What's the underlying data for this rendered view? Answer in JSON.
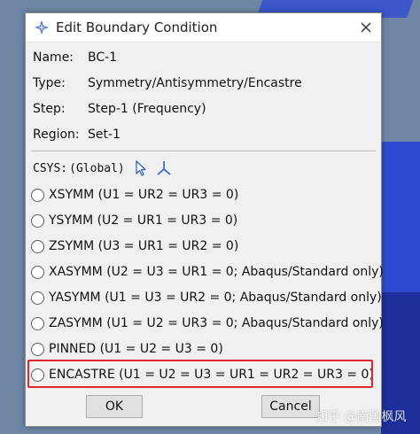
{
  "dialog": {
    "title": "Edit Boundary Condition",
    "info": [
      {
        "label": "Name:",
        "value": "BC-1"
      },
      {
        "label": "Type:",
        "value": "Symmetry/Antisymmetry/Encastre"
      },
      {
        "label": "Step:",
        "value": "Step-1 (Frequency)"
      },
      {
        "label": "Region:",
        "value": "Set-1"
      }
    ],
    "csys_label": "CSYS:",
    "csys_value": "(Global)",
    "options": [
      "XSYMM (U1 = UR2 = UR3 = 0)",
      "YSYMM (U2 = UR1 = UR3 = 0)",
      "ZSYMM (U3 = UR1 = UR2 = 0)",
      "XASYMM (U2 = U3 = UR1 = 0; Abaqus/Standard only)",
      "YASYMM (U1 = U3 = UR2 = 0; Abaqus/Standard only)",
      "ZASYMM (U1 = U2 = UR3 = 0; Abaqus/Standard only)",
      "PINNED (U1 = U2 = U3 = 0)",
      "ENCASTRE (U1 = U2 = U3 = UR1 = UR2 = UR3 = 0)"
    ],
    "highlighted_option": "ENCASTRE (U1 = U2 = U3 = UR1 = UR2 = UR3 = 0)",
    "highlight_color": "#e0272d",
    "ok_label": "OK",
    "cancel_label": "Cancel"
  },
  "watermark": "知乎 @南国枫风",
  "icons": {
    "title": "abaqus-app-icon",
    "close": "close-icon",
    "select_csys": "arrow-cursor-icon",
    "create_csys": "csys-triad-icon"
  }
}
